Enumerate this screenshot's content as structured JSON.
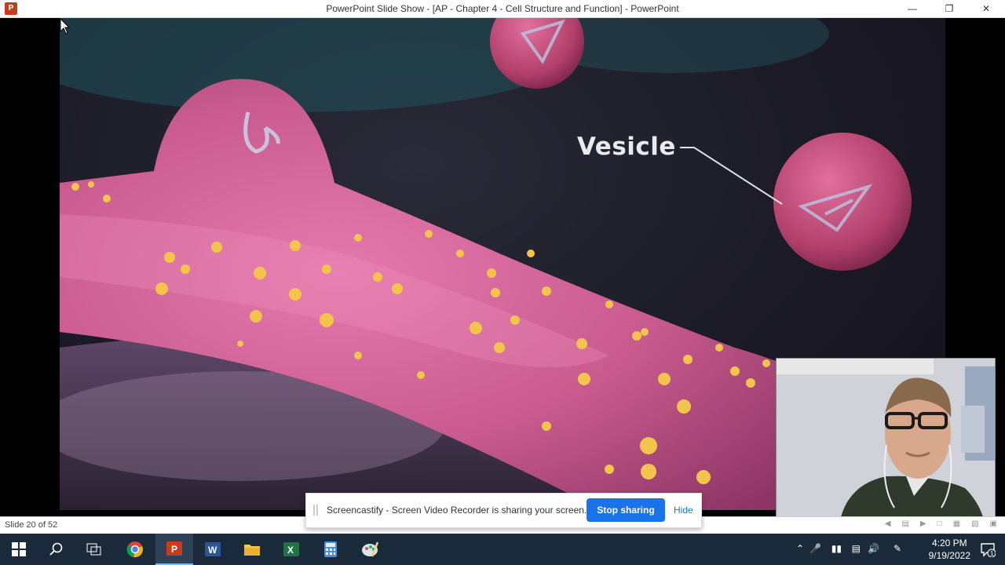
{
  "window": {
    "title": "PowerPoint Slide Show - [AP - Chapter 4 - Cell Structure and Function] - PowerPoint",
    "minimize_icon": "minimize-icon",
    "restore_icon": "restore-icon",
    "close_icon": "close-icon"
  },
  "slide": {
    "label": "Vesicle"
  },
  "statusbar": {
    "slide_counter": "Slide 20 of 52"
  },
  "share_bar": {
    "message": "Screencastify - Screen Video Recorder is sharing your screen.",
    "stop_label": "Stop sharing",
    "hide_label": "Hide"
  },
  "taskbar": {
    "items": [
      "start-icon",
      "search-icon",
      "task-view-icon",
      "chrome-icon",
      "powerpoint-icon",
      "word-icon",
      "file-explorer-icon",
      "excel-icon",
      "calculator-icon",
      "paint-icon"
    ],
    "time": "4:20 PM",
    "date": "9/19/2022",
    "notification_count": "1"
  }
}
